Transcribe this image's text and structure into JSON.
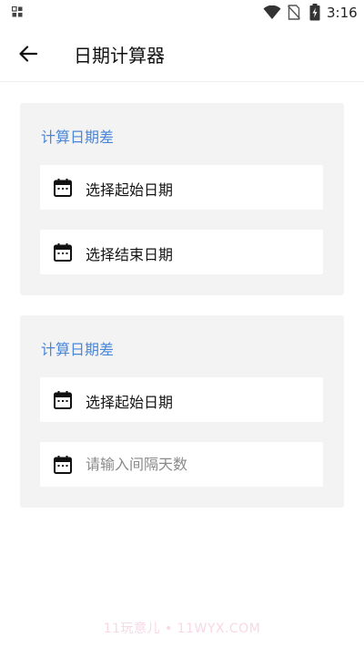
{
  "status_bar": {
    "time": "3:16",
    "icons": [
      "app-grid-icon",
      "wifi-icon",
      "no-sim-icon",
      "battery-charging-icon"
    ]
  },
  "app_bar": {
    "title": "日期计算器",
    "back_icon": "arrow-back-icon"
  },
  "cards": [
    {
      "title": "计算日期差",
      "fields": [
        {
          "icon": "calendar-icon",
          "label": "选择起始日期"
        },
        {
          "icon": "calendar-icon",
          "label": "选择结束日期"
        }
      ]
    },
    {
      "title": "计算日期差",
      "fields": [
        {
          "icon": "calendar-icon",
          "label": "选择起始日期"
        },
        {
          "icon": "calendar-icon",
          "placeholder": "请输入间隔天数",
          "value": ""
        }
      ]
    }
  ],
  "watermark": "11玩意儿 • 11WYX.COM",
  "colors": {
    "accent": "#4a86d8",
    "card_bg": "#f3f3f3",
    "field_bg": "#ffffff"
  }
}
